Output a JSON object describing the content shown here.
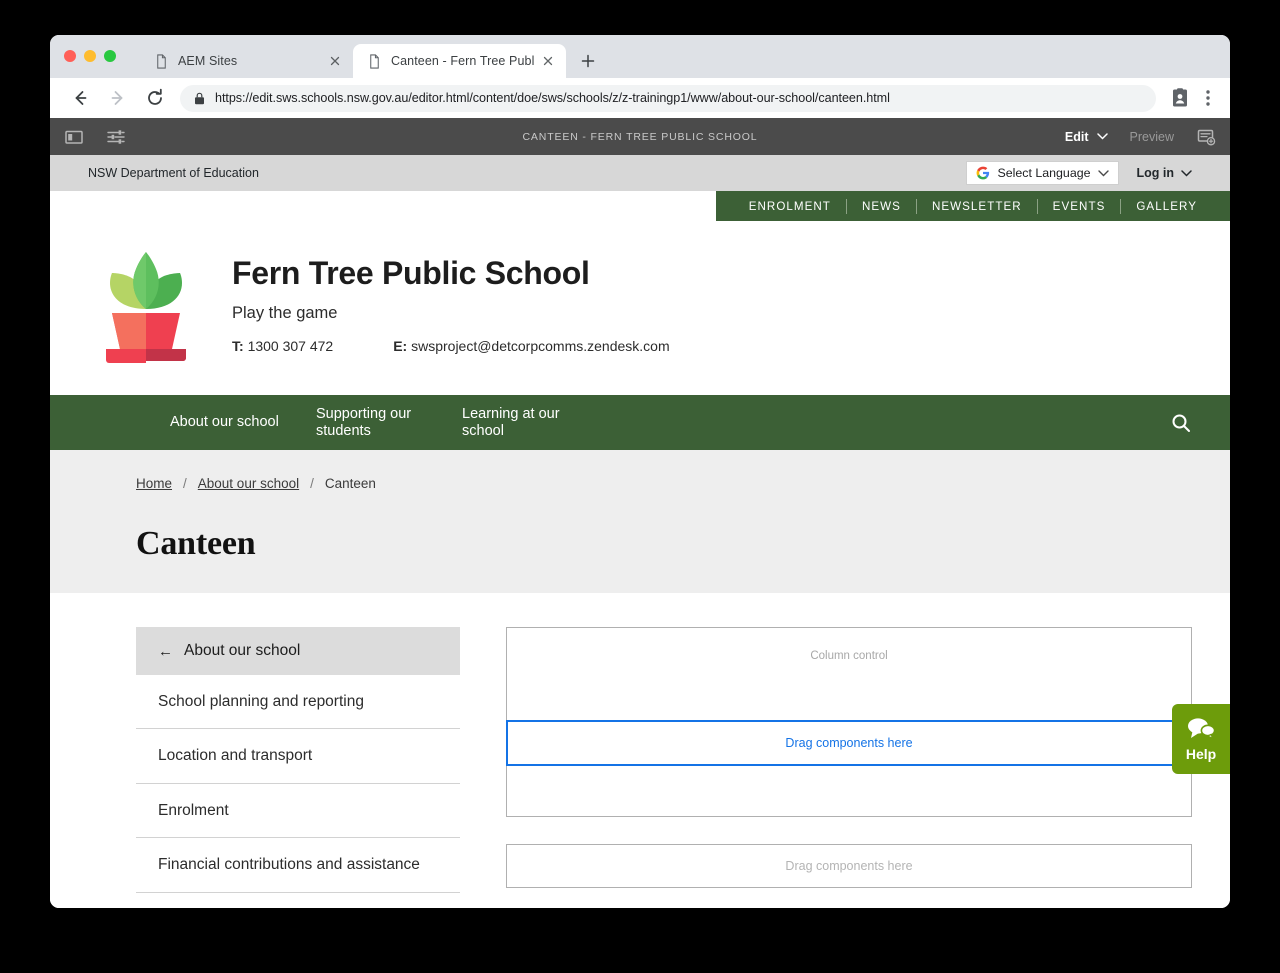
{
  "browser": {
    "tabs": [
      {
        "title": "AEM Sites",
        "active": false,
        "favicon": "page-icon"
      },
      {
        "title": "Canteen - Fern Tree Public Sch",
        "active": true,
        "favicon": "page-icon"
      }
    ],
    "new_tab_label": "+",
    "nav": {
      "back": "back-arrow-icon",
      "forward": "forward-arrow-icon",
      "reload": "reload-icon"
    },
    "omnibox": {
      "url_scheme": "https://",
      "url_host": "edit.sws.schools.nsw.gov.au",
      "url_path": "/editor.html/content/doe/sws/schools/z/z-trainingp1/www/about-our-school/canteen.html",
      "url_full": "https://edit.sws.schools.nsw.gov.au/editor.html/content/doe/sws/schools/z/z-trainingp1/www/about-our-school/canteen.html",
      "lock": "lock-icon"
    },
    "toolbar_icons": [
      "profile-card-icon",
      "chrome-menu-icon"
    ]
  },
  "aem": {
    "sidebar_toggle": "panel-toggle-icon",
    "page_info": "sliders-icon",
    "page_title": "CANTEEN - FERN TREE PUBLIC SCHOOL",
    "mode_label": "Edit",
    "mode_caret": "chevron-down-icon",
    "preview_label": "Preview",
    "page_properties_icon": "page-add-icon"
  },
  "site": {
    "utility": {
      "department": "NSW Department of Education",
      "language_label": "Select Language",
      "language_icon": "google-g-icon",
      "language_caret": "chevron-down-icon",
      "login_label": "Log in",
      "login_caret": "chevron-down-icon"
    },
    "quicklinks": [
      "ENROLMENT",
      "NEWS",
      "NEWSLETTER",
      "EVENTS",
      "GALLERY"
    ],
    "masthead": {
      "logo": "potted-plant-logo",
      "school_name": "Fern Tree Public School",
      "tagline": "Play the game",
      "phone_label": "T:",
      "phone": "1300 307 472",
      "email_label": "E:",
      "email": "swsproject@detcorpcomms.zendesk.com"
    },
    "mainnav": {
      "items": [
        "About our school",
        "Supporting our\nstudents",
        "Learning at our\nschool"
      ],
      "item_1": "About our school",
      "item_2_line1": "Supporting our",
      "item_2_line2": "students",
      "item_3_line1": "Learning at our",
      "item_3_line2": "school",
      "search_icon": "search-icon"
    },
    "breadcrumb": {
      "home": "Home",
      "sep": "/",
      "parent": "About our school",
      "current": "Canteen"
    },
    "page_title": "Canteen",
    "side_nav": {
      "header": "About our school",
      "back_arrow": "←",
      "items": [
        "School planning and reporting",
        "Location and transport",
        "Enrolment",
        "Financial contributions and assistance"
      ]
    }
  },
  "editor": {
    "column_control_label": "Column control",
    "dropzone_active_label": "Drag components here",
    "dropzone_idle_label": "Drag components here"
  },
  "help": {
    "label": "Help",
    "icon": "chat-bubbles-icon"
  },
  "colors": {
    "brand_green": "#3c6036",
    "help_green": "#6d9c0b",
    "aem_bar": "#4b4b4b",
    "accent_blue": "#1473e6",
    "utility_gray": "#d7d7d7",
    "title_band": "#eeeeee"
  }
}
